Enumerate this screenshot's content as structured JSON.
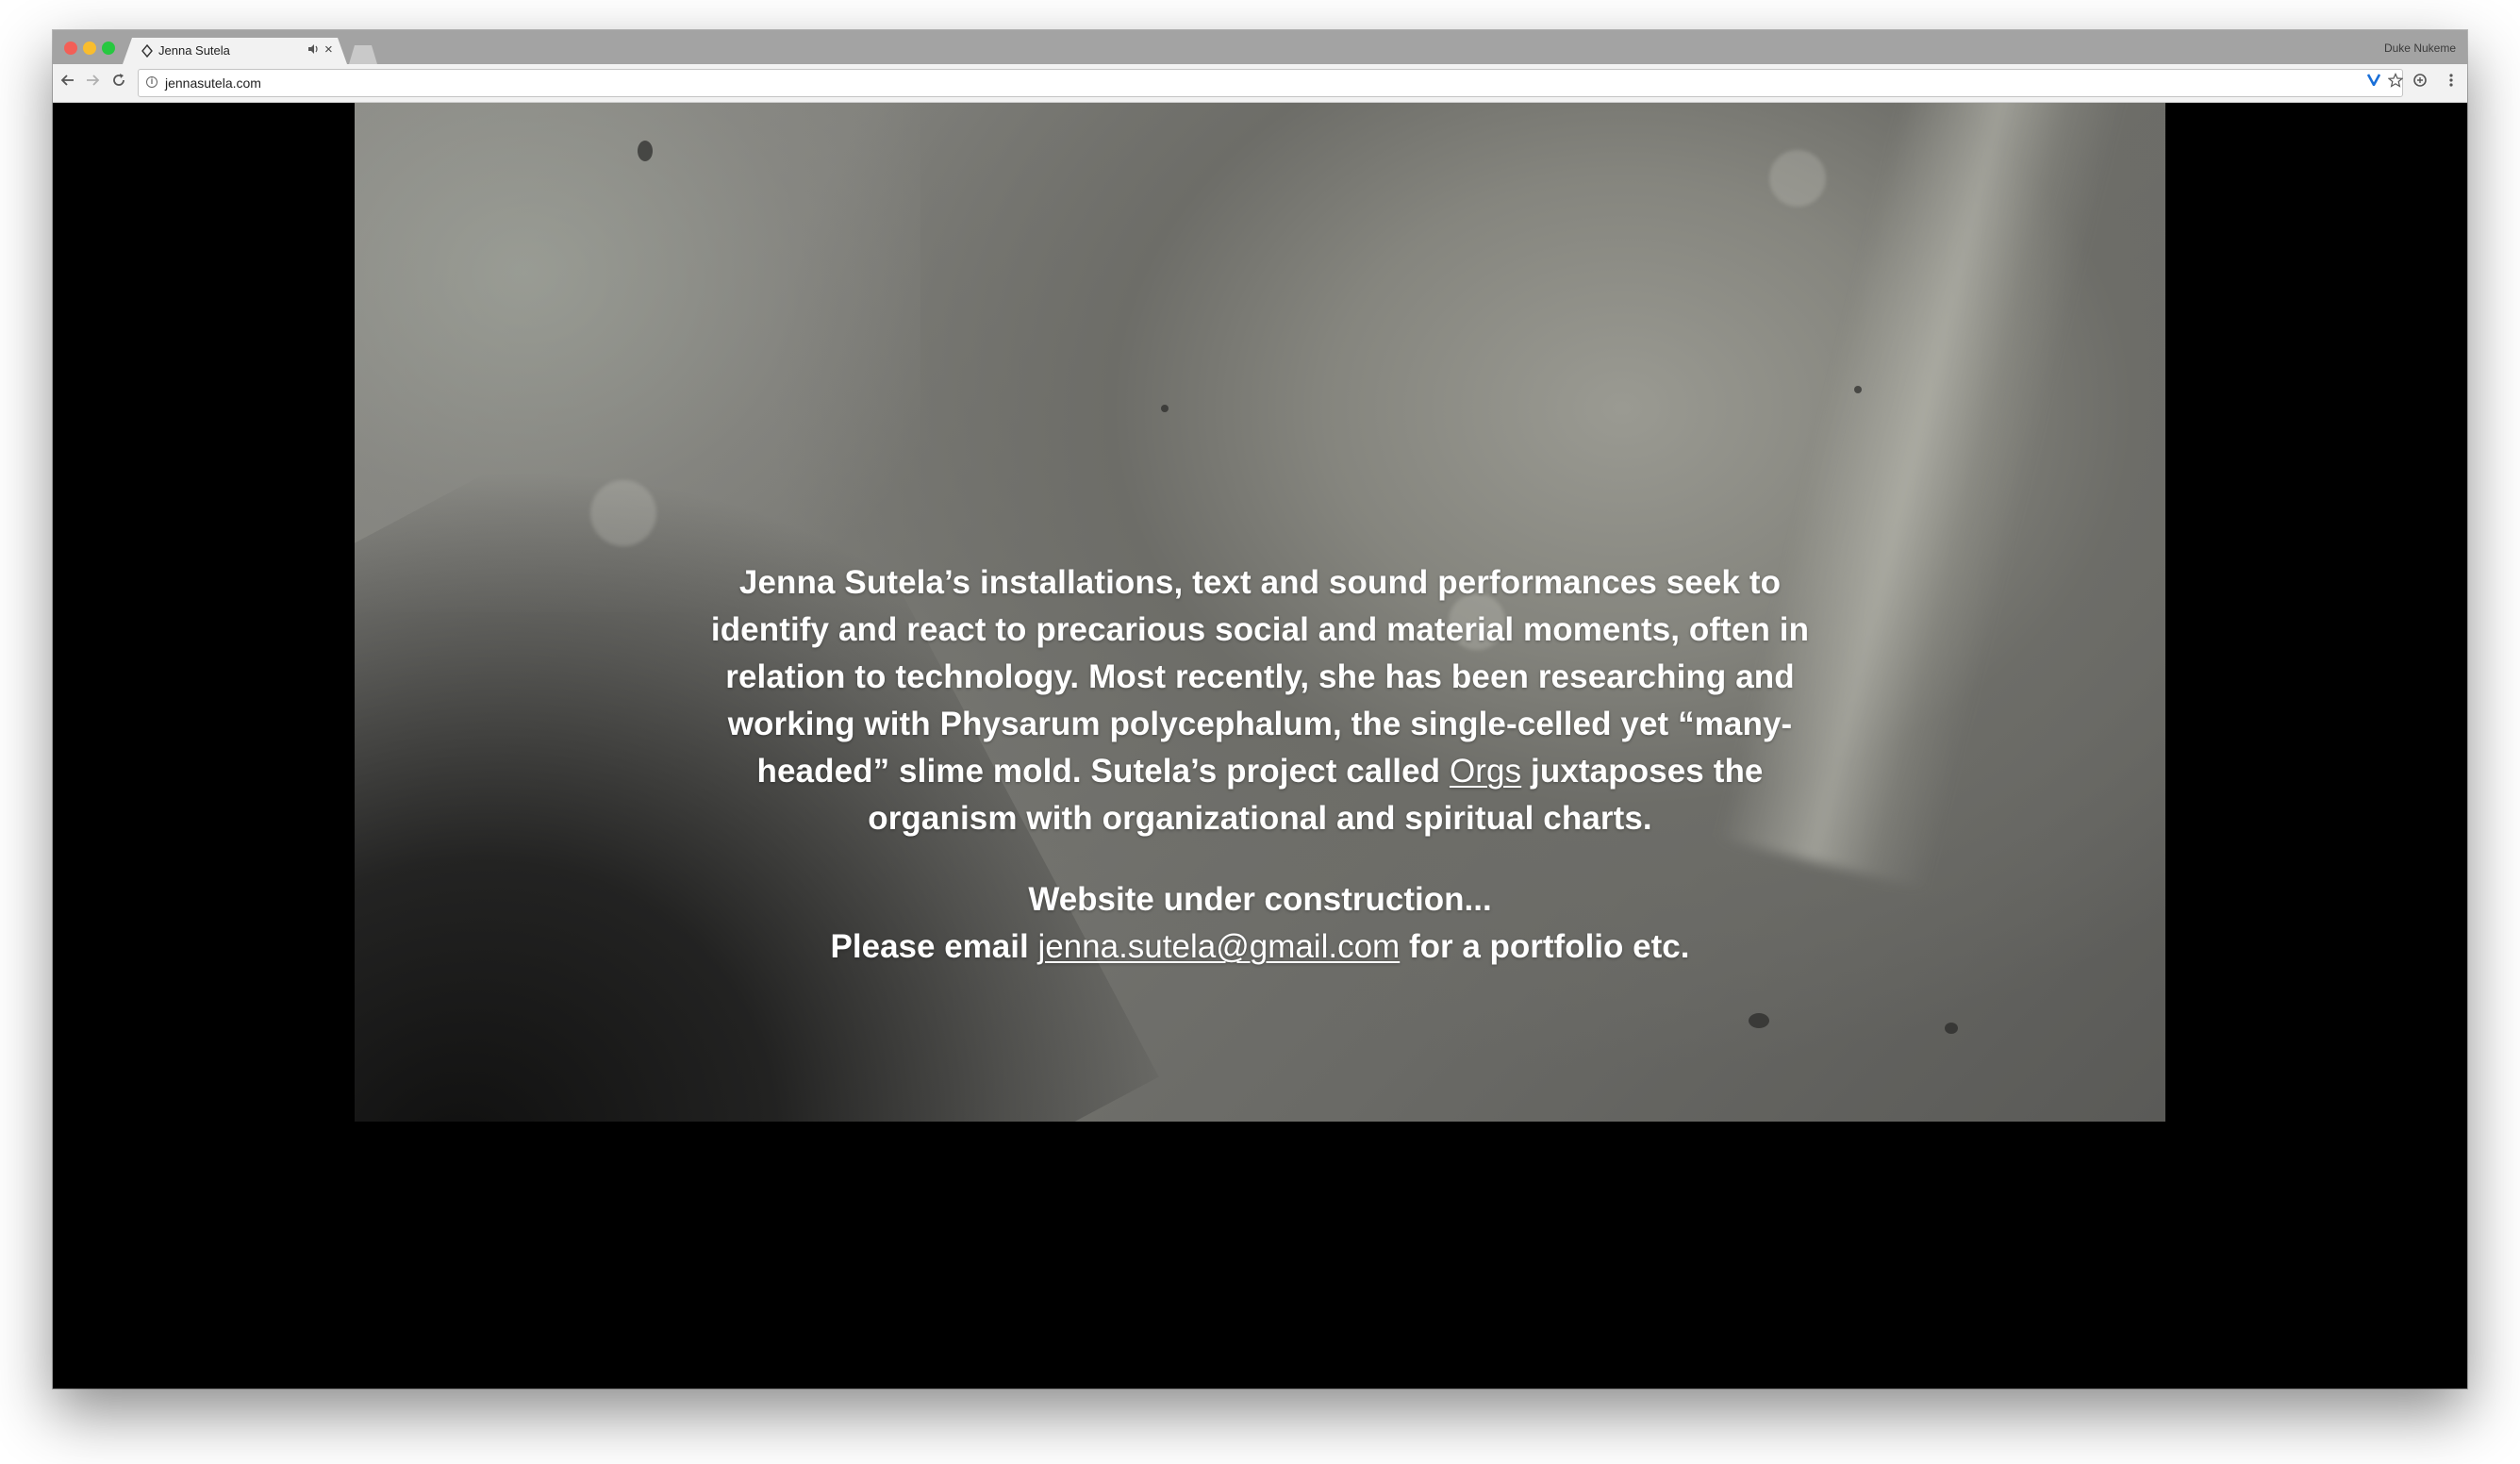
{
  "browser": {
    "tab_title": "Jenna Sutela",
    "tab_audio_icon": "speaker-icon",
    "tab_close_glyph": "×",
    "profile_name": "Duke Nukeme",
    "url": "jennasutela.com",
    "nav": {
      "back_icon": "arrow-left-icon",
      "forward_icon": "arrow-right-icon",
      "reload_icon": "reload-icon"
    },
    "extensions": [
      "v-extension-icon",
      "star-icon",
      "shield-icon",
      "menu-icon"
    ]
  },
  "page": {
    "bio_part1": "Jenna Sutela’s installations, text and sound performances seek to identify and react to precarious social and material moments, often in relation to technology. Most recently, she has been researching and working with Physarum polycephalum, the single-celled yet “many-headed” slime mold. Sutela’s project called ",
    "orgs_link": "Orgs",
    "bio_part2": " juxtaposes the organism with organizational and spiritual charts.",
    "construction_notice": "Website under construction...",
    "email_prefix": "Please email ",
    "email_link": "jenna.sutela@gmail.com",
    "email_suffix": " for a portfolio etc."
  },
  "colors": {
    "page_background": "#000000",
    "text": "#ffffff",
    "tab_strip": "#a3a3a3",
    "toolbar": "#f2f2f2"
  }
}
